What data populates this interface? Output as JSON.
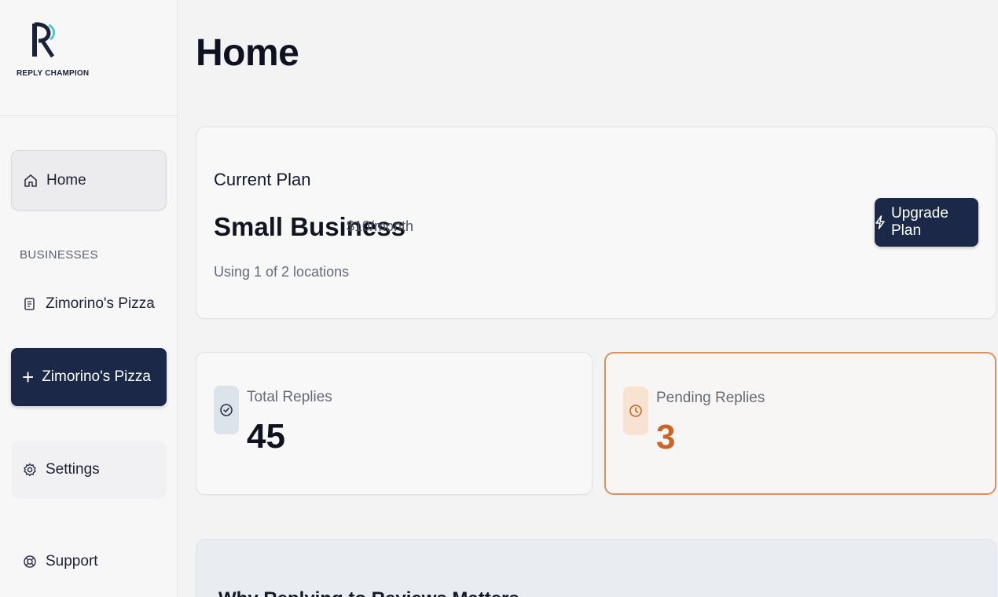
{
  "brand": {
    "name": "REPLY CHAMPION",
    "accent": "#4fc9c2"
  },
  "sidebar": {
    "home_label": "Home",
    "section_label": "BUSINESSES",
    "business_label": "Zimorino's Pizza",
    "add_business_label": "Zimorino's Pizza",
    "settings_label": "Settings",
    "support_label": "Support"
  },
  "main": {
    "title": "Home",
    "plan": {
      "label": "Current Plan",
      "name": "Small Business",
      "price": "$10/month",
      "usage": "Using 1 of 2 locations",
      "upgrade_label": "Upgrade Plan"
    },
    "stats": {
      "total": {
        "label": "Total Replies",
        "value": "45"
      },
      "pending": {
        "label": "Pending Replies",
        "value": "3",
        "accent": "#c9652a"
      }
    },
    "why_title": "Why Replying to Reviews Matters"
  },
  "icons": {
    "home": "home-icon",
    "business": "store-icon",
    "add": "plus-icon",
    "settings": "gear-icon",
    "support": "lifebuoy-icon",
    "upgrade": "bolt-icon",
    "total": "check-circle-icon",
    "pending": "clock-icon",
    "chevron": "chevron-right-icon"
  },
  "colors": {
    "primary": "#1b2847",
    "pending": "#d9915e"
  }
}
